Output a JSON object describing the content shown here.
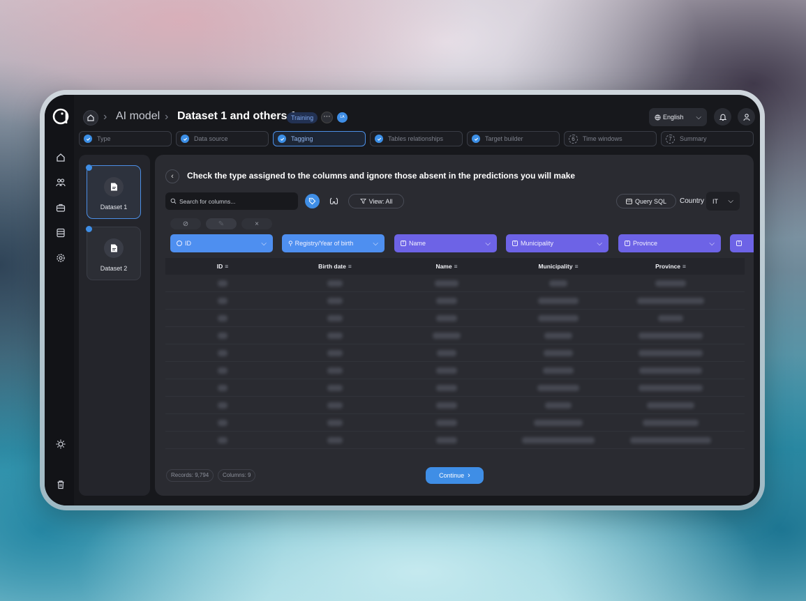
{
  "header": {
    "breadcrumb_model": "AI model",
    "breadcrumb_title": "Dataset 1 and others 1",
    "status_badge": "Training",
    "more_label": "⋯",
    "avatar_initials": "LA",
    "language": "English"
  },
  "steps": [
    {
      "label": "Type",
      "state": "done"
    },
    {
      "label": "Data source",
      "state": "done"
    },
    {
      "label": "Tagging",
      "state": "active"
    },
    {
      "label": "Tables relationships",
      "state": "done"
    },
    {
      "label": "Target builder",
      "state": "done"
    },
    {
      "label": "Time windows",
      "number": "6",
      "state": "pending"
    },
    {
      "label": "Summary",
      "number": "7",
      "state": "pending"
    }
  ],
  "datasets": [
    {
      "label": "Dataset 1",
      "selected": true
    },
    {
      "label": "Dataset 2",
      "selected": false
    }
  ],
  "main": {
    "title": "Check the type assigned to the columns and ignore those absent in the predictions you will make",
    "search_placeholder": "Search for columns...",
    "view_filter": "View: All",
    "query_sql": "Query SQL",
    "country_label": "Country",
    "country_value": "IT"
  },
  "column_types": [
    {
      "label": "ID",
      "icon": "key-icon",
      "color": "#4e8ff0"
    },
    {
      "label": "Registry/Year of birth",
      "icon": "person-icon",
      "color": "#4e8ff0"
    },
    {
      "label": "Name",
      "icon": "text-type-icon",
      "color": "#6d63e6"
    },
    {
      "label": "Municipality",
      "icon": "text-type-icon",
      "color": "#6d63e6"
    },
    {
      "label": "Province",
      "icon": "text-type-icon",
      "color": "#6d63e6"
    }
  ],
  "table": {
    "headers": [
      "ID",
      "Birth date",
      "Name",
      "Municipality",
      "Province"
    ]
  },
  "footer": {
    "records": "Records: 9,794",
    "columns": "Columns: 9",
    "continue_label": "Continue"
  },
  "colors": {
    "accent_blue": "#3f8ee6",
    "chip_purple": "#6d63e6",
    "chip_blue": "#4e8ff0",
    "panel_bg": "#2a2b31"
  }
}
